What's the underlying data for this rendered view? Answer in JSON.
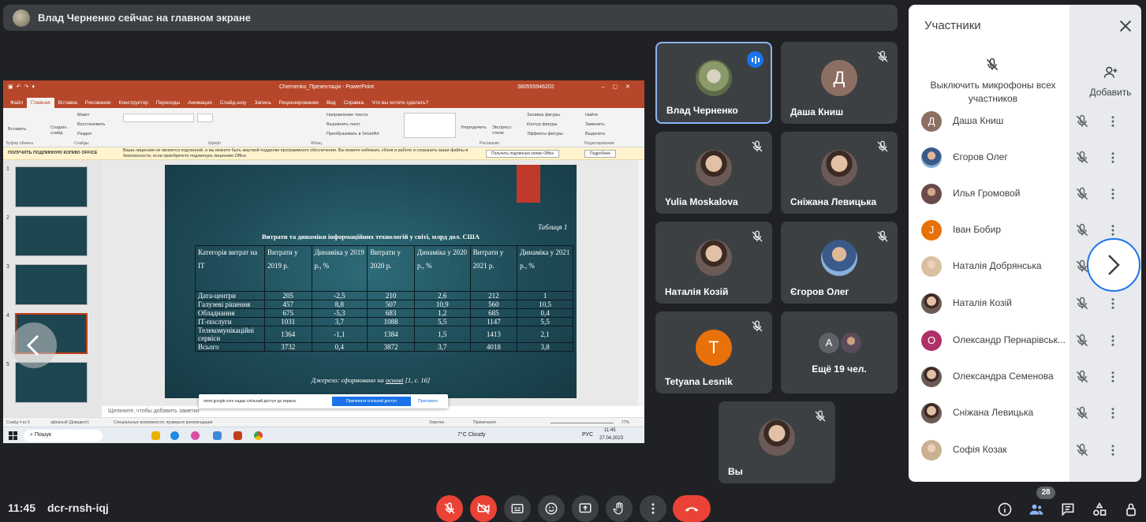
{
  "banner": {
    "text": "Влад Черненко сейчас на главном экране"
  },
  "ppt": {
    "window_title": "Chernenko_Презентація - PowerPoint",
    "account": "380555946202",
    "tabs": [
      "Файл",
      "Главная",
      "Вставка",
      "Рисование",
      "Конструктор",
      "Переходы",
      "Анимация",
      "Слайд-шоу",
      "Запись",
      "Рецензирование",
      "Вид",
      "Справка",
      "Что вы хотите сделать?"
    ],
    "active_tab": "Главная",
    "ribbon": {
      "groups": [
        "Буфер обмена",
        "Слайды",
        "Шрифт",
        "Абзац",
        "Рисование",
        "Редактирование"
      ],
      "paste": "Вставить",
      "new_slide": "Создать слайд",
      "layout": "Макет",
      "reset": "Восстановить",
      "section": "Раздел",
      "text_direction": "Направление текста",
      "align_text": "Выровнять текст",
      "smartart": "Преобразовать в SmartArt",
      "arrange": "Упорядочить",
      "quick_styles": "Экспресс-стили",
      "shape_fill": "Заливка фигуры",
      "shape_outline": "Контур фигуры",
      "shape_effects": "Эффекты фигуры",
      "find": "Найти",
      "replace": "Заменить",
      "select": "Выделить"
    },
    "infobar": {
      "title": "ПОЛУЧИТЬ ПОДЛИННУЮ КОПИЮ OFFICE",
      "message": "Ваша лицензия не является подлинной, и вы можете быть жертвой подделки программного обеспечения. Вы можете избежать сбоев в работе и сохранить ваши файлы в безопасности, если приобретете подлинную лицензию Office.",
      "btn_get": "Получить подлинную копию Office",
      "btn_more": "Подробнее"
    },
    "slide_numbers": [
      "1",
      "2",
      "3",
      "4",
      "5"
    ],
    "slide": {
      "table_note": "Таблиця 1",
      "title": "Витрати та динаміки інформаційних технологій у світі, млрд дол. США",
      "headers": [
        "Категорія витрат на ІТ",
        "Витрати у 2019 р.",
        "Динаміка у 2019 р., %",
        "Витрати у 2020 р.",
        "Динаміка у 2020 р., %",
        "Витрати у 2021 р.",
        "Динаміка у 2021 р., %"
      ],
      "rows": [
        [
          "Дата-центри",
          "205",
          "-2,5",
          "210",
          "2,6",
          "212",
          "1"
        ],
        [
          "Галузеві рішення",
          "457",
          "8,8",
          "507",
          "10,9",
          "560",
          "10,5"
        ],
        [
          "Обладнання",
          "675",
          "-5,3",
          "683",
          "1,2",
          "685",
          "0,4"
        ],
        [
          "ІТ-послуги",
          "1031",
          "3,7",
          "1088",
          "5,5",
          "1147",
          "5,5"
        ],
        [
          "Телекомунікаційні сервіси",
          "1364",
          "-1,1",
          "1384",
          "1,5",
          "1413",
          "2,1"
        ],
        [
          "Всього",
          "3732",
          "0,4",
          "3872",
          "3,7",
          "4018",
          "3,8"
        ]
      ],
      "source_prefix": "Джерело:",
      "source_mid": " сформовано на ",
      "source_link": "основі",
      "source_suffix": " [1, с. 16]"
    },
    "notes_placeholder": "Щелкните, чтобы добавить заметки",
    "share_popup": {
      "text": "meet.google.com надає спільний доступ до екрана.",
      "stop": "Припинити спільний доступ",
      "hide": "Приховати"
    },
    "status": {
      "slide_info": "Слайд 4 из 5",
      "theme": "аферный (Дивидент)",
      "accessibility": "Специальные возможности: проверьте рекомендации",
      "notes": "Заметки",
      "comments": "Примечания",
      "zoom": "77%"
    },
    "taskbar": {
      "search": "Пошук",
      "weather": "7°C Cloudy",
      "lang": "РУС",
      "time": "11:45",
      "date": "27.04.2023"
    }
  },
  "tiles": [
    {
      "name": "Влад Черненко",
      "speaking": true
    },
    {
      "name": "Даша Книш",
      "initial": "Д",
      "color": "#8d6e63"
    },
    {
      "name": "Yulia Moskalova"
    },
    {
      "name": "Сніжана Левицька"
    },
    {
      "name": "Наталія Козій"
    },
    {
      "name": "Єгоров Олег"
    },
    {
      "name": "Tetyana Lesnik",
      "initial": "T",
      "color": "#e8710a"
    },
    {
      "name": "Ещё 19 чел.",
      "initial": "A"
    },
    {
      "name": "Вы"
    }
  ],
  "panel": {
    "title": "Участники",
    "mute_all": "Выключить микрофоны всех участников",
    "add": "Добавить",
    "participants": [
      {
        "name": "Даша Книш",
        "initial": "Д",
        "color": "#8d6e63"
      },
      {
        "name": "Єгоров Олег"
      },
      {
        "name": "Илья Громовой"
      },
      {
        "name": "Іван Бобир",
        "initial": "J",
        "color": "#e8710a"
      },
      {
        "name": "Наталія Добрянська"
      },
      {
        "name": "Наталія Козій"
      },
      {
        "name": "Олександр Пернарівськ...",
        "initial": "O",
        "color": "#b0306a"
      },
      {
        "name": "Олександра Семенова"
      },
      {
        "name": "Сніжана Левицька"
      },
      {
        "name": "Софія Козак"
      }
    ]
  },
  "bottom": {
    "time": "11:45",
    "code": "dcr-rnsh-iqj",
    "participants_count": "28"
  },
  "colors": {
    "accent": "#1a73e8",
    "danger": "#ea4335",
    "ppt": "#b7472a"
  }
}
